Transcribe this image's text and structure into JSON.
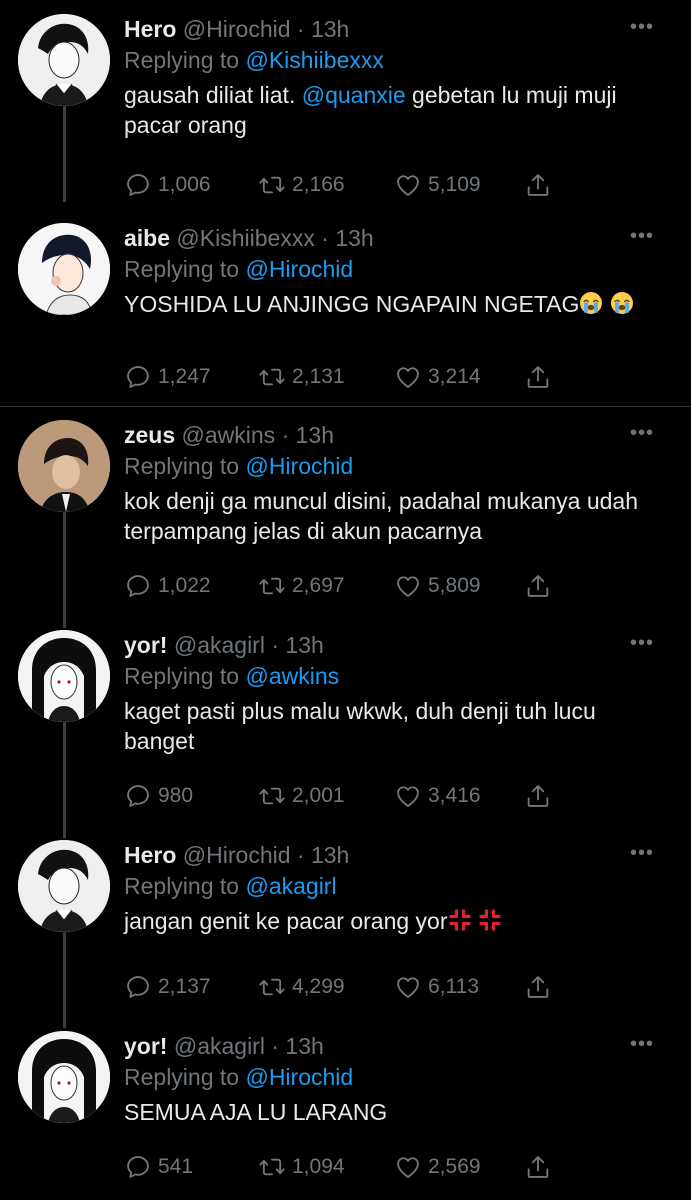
{
  "tweets": [
    {
      "name": "Hero",
      "handle": "@Hirochid",
      "time": "13h",
      "reply_prefix": "Replying to",
      "reply_to": "@Kishiibexxx",
      "text_before": "gausah diliat liat. ",
      "text_mention": "@quanxie",
      "text_after": " gebetan lu muji muji pacar orang",
      "replies": "1,006",
      "retweets": "2,166",
      "likes": "5,109"
    },
    {
      "name": "aibe",
      "handle": "@Kishiibexxx",
      "time": "13h",
      "reply_prefix": "Replying to",
      "reply_to": "@Hirochid",
      "text": "YOSHIDA LU ANJINGG NGAPAIN NGETAG",
      "emoji": [
        "crying-face",
        "crying-face"
      ],
      "replies": "1,247",
      "retweets": "2,131",
      "likes": "3,214"
    },
    {
      "name": "zeus",
      "handle": "@awkins",
      "time": "13h",
      "reply_prefix": "Replying to",
      "reply_to": "@Hirochid",
      "text": "kok denji ga muncul disini, padahal mukanya udah terpampang jelas di akun pacarnya",
      "replies": "1,022",
      "retweets": "2,697",
      "likes": "5,809"
    },
    {
      "name": "yor!",
      "handle": "@akagirl",
      "time": "13h",
      "reply_prefix": "Replying to",
      "reply_to": "@awkins",
      "text": "kaget pasti plus malu wkwk, duh denji tuh lucu banget",
      "replies": "980",
      "retweets": "2,001",
      "likes": "3,416"
    },
    {
      "name": "Hero",
      "handle": "@Hirochid",
      "time": "13h",
      "reply_prefix": "Replying to",
      "reply_to": "@akagirl",
      "text": "jangan genit ke pacar orang yor",
      "emoji": [
        "anger-symbol",
        "anger-symbol"
      ],
      "replies": "2,137",
      "retweets": "4,299",
      "likes": "6,113"
    },
    {
      "name": "yor!",
      "handle": "@akagirl",
      "time": "13h",
      "reply_prefix": "Replying to",
      "reply_to": "@Hirochid",
      "text": "SEMUA AJA LU LARANG",
      "replies": "541",
      "retweets": "1,094",
      "likes": "2,569"
    }
  ],
  "icons": {
    "reply": "reply-icon",
    "retweet": "retweet-icon",
    "like": "heart-icon",
    "share": "share-icon",
    "more": "more-options-icon"
  },
  "colors": {
    "background": "#000000",
    "text": "#e7e9ea",
    "muted": "#71767b",
    "link": "#1d9bf0",
    "divider": "#2f3336"
  }
}
